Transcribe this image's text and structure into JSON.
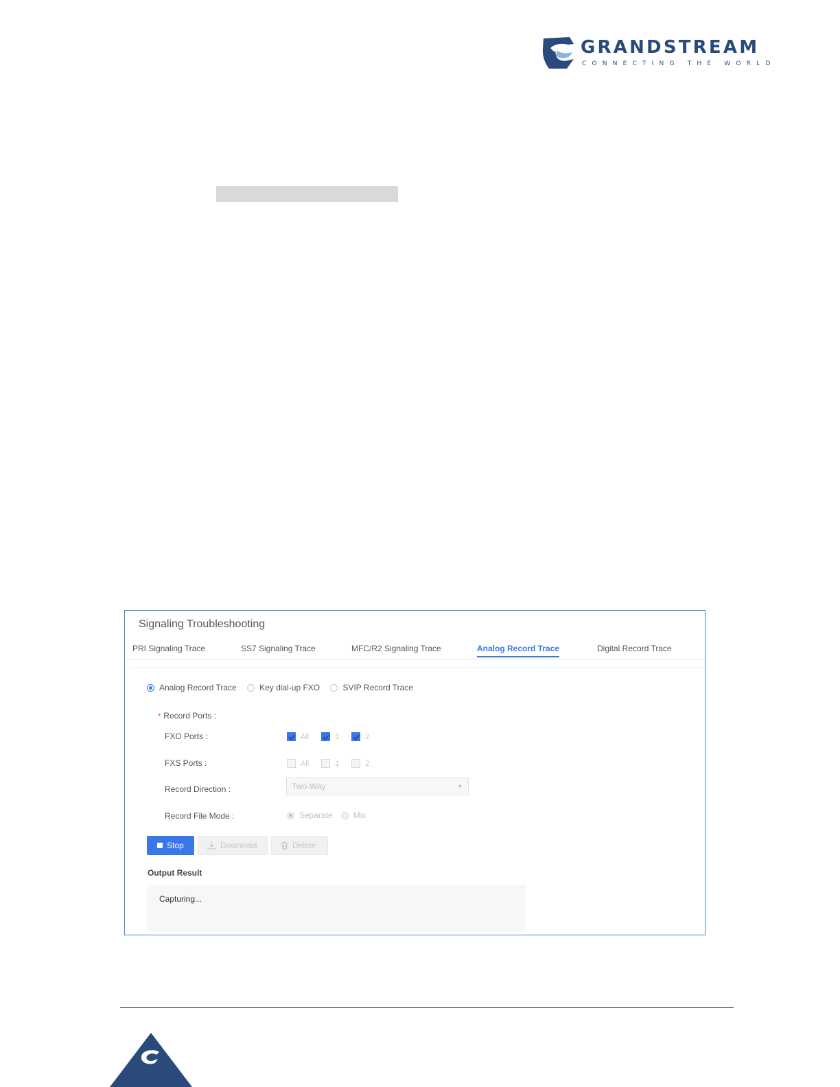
{
  "header": {
    "brand": "GRANDSTREAM",
    "tagline": "CONNECTING THE WORLD"
  },
  "screenshot": {
    "title": "Signaling Troubleshooting",
    "tabs": [
      {
        "label": "PRI Signaling Trace",
        "active": false
      },
      {
        "label": "SS7 Signaling Trace",
        "active": false
      },
      {
        "label": "MFC/R2 Signaling Trace",
        "active": false
      },
      {
        "label": "Analog Record Trace",
        "active": true
      },
      {
        "label": "Digital Record Trace",
        "active": false
      }
    ],
    "trace_type": {
      "options": [
        "Analog Record Trace",
        "Key dial-up FXO",
        "SVIP Record Trace"
      ],
      "selected": "Analog Record Trace"
    },
    "record_ports_label": "Record Ports :",
    "fxo_ports": {
      "label": "FXO Ports :",
      "options": [
        "All",
        "1",
        "2"
      ],
      "checked": [
        true,
        true,
        true
      ]
    },
    "fxs_ports": {
      "label": "FXS Ports :",
      "options": [
        "All",
        "1",
        "2"
      ],
      "checked": [
        false,
        false,
        false
      ]
    },
    "record_direction": {
      "label": "Record Direction :",
      "value": "Two-Way"
    },
    "record_file_mode": {
      "label": "Record File Mode :",
      "options": [
        "Separate",
        "Mix"
      ],
      "selected": "Separate"
    },
    "buttons": {
      "stop": "Stop",
      "download": "Download",
      "delete": "Delete"
    },
    "output": {
      "label": "Output Result",
      "text": "Capturing..."
    }
  },
  "colors": {
    "brand_blue": "#2b4a7c",
    "accent": "#3b78e7",
    "frame_border": "#4a86c8"
  }
}
